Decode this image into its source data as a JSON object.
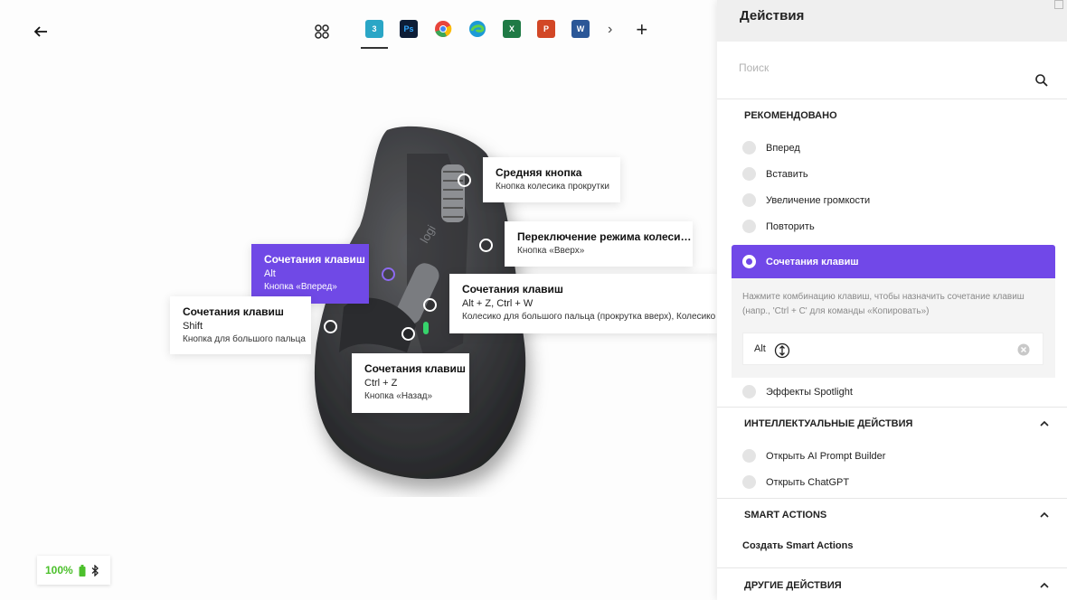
{
  "toolbar": {
    "apps": [
      {
        "name": "3ds-max",
        "abbr": "3",
        "color": "#2aa6c6",
        "active": true
      },
      {
        "name": "photoshop",
        "abbr": "Ps",
        "color": "#0d1d36"
      },
      {
        "name": "chrome",
        "abbr": "",
        "color": "#e8453c"
      },
      {
        "name": "edge",
        "abbr": "",
        "color": "#1d9ad6"
      },
      {
        "name": "excel",
        "abbr": "X",
        "color": "#1f7a45"
      },
      {
        "name": "powerpoint",
        "abbr": "P",
        "color": "#d24726"
      },
      {
        "name": "word",
        "abbr": "W",
        "color": "#2b5797"
      }
    ],
    "more": "›",
    "add": "+"
  },
  "callouts": {
    "middle": {
      "title": "Средняя кнопка",
      "sub": "Кнопка колесика прокрутки"
    },
    "wheel_mode": {
      "title": "Переключение режима колеси…",
      "sub": "Кнопка «Вверх»"
    },
    "forward": {
      "title": "Сочетания клавиш",
      "value": "Alt",
      "sub": "Кнопка «Вперед»"
    },
    "thumbwheel": {
      "title": "Сочетания клавиш",
      "value": "Alt + Z,   Ctrl + W",
      "sub": "Колесико для большого пальца (прокрутка вверх), Колесико д"
    },
    "gesture": {
      "title": "Сочетания клавиш",
      "value": "Shift",
      "sub": "Кнопка для большого пальца"
    },
    "back": {
      "title": "Сочетания клавиш",
      "value": "Ctrl + Z",
      "sub": "Кнопка «Назад»"
    }
  },
  "battery": {
    "percent": "100%",
    "color": "#4cc02c"
  },
  "panel": {
    "title": "Действия",
    "search_placeholder": "Поиск",
    "recommended_title": "РЕКОМЕНДОВАНО",
    "recommended": [
      "Вперед",
      "Вставить",
      "Увеличение громкости",
      "Повторить"
    ],
    "selected": "Сочетания клавиш",
    "hint": "Нажмите комбинацию клавиш, чтобы назначить сочетание клавиш (напр., 'Ctrl + C' для команды «Копировать»)",
    "shortcut_value": "Alt",
    "after_selected": "Эффекты Spotlight",
    "smart_title": "ИНТЕЛЛЕКТУАЛЬНЫЕ ДЕЙСТВИЯ",
    "smart": [
      "Открыть AI Prompt Builder",
      "Открыть ChatGPT"
    ],
    "smart_actions_title": "SMART ACTIONS",
    "create_smart": "Создать Smart Actions",
    "other_title": "ДРУГИЕ ДЕЙСТВИЯ",
    "accent": "#7148e8"
  }
}
